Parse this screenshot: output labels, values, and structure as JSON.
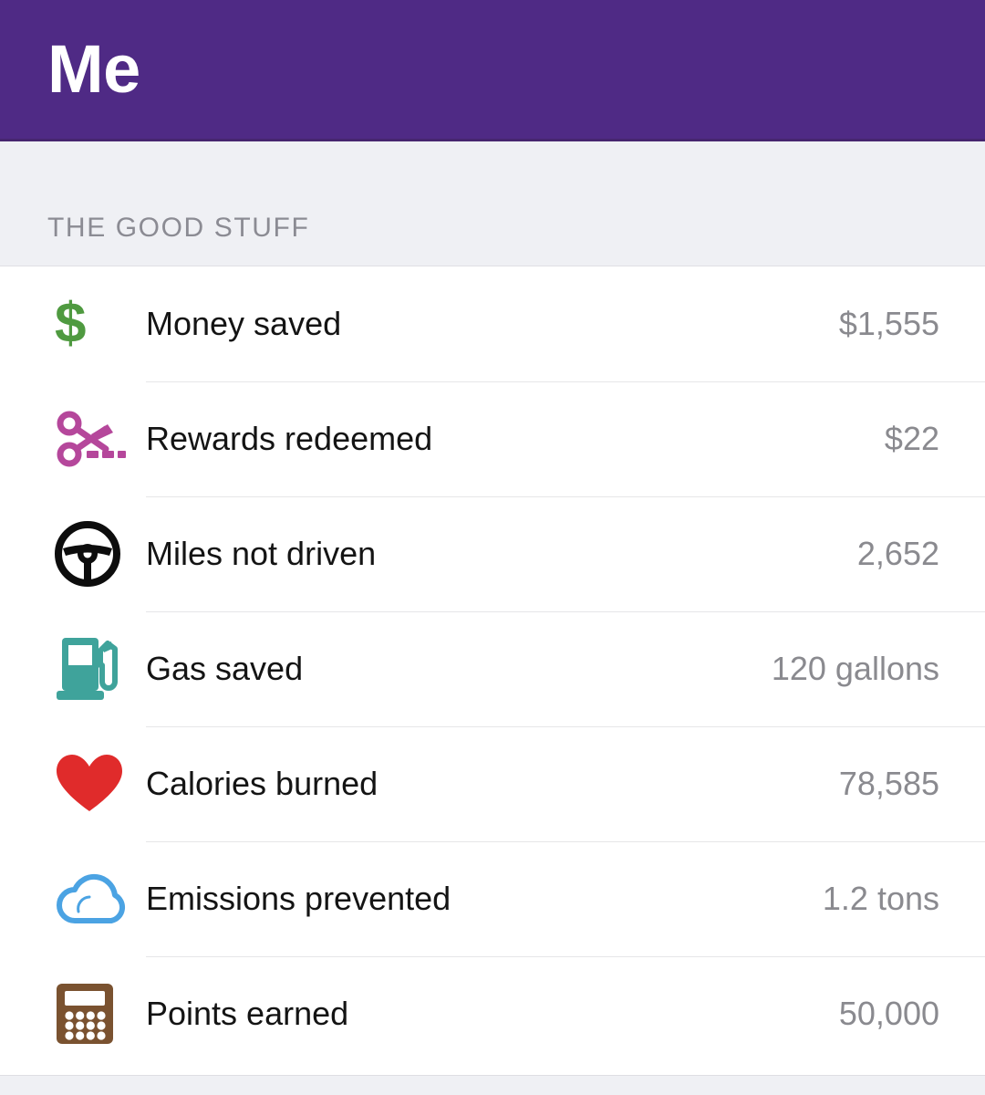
{
  "header": {
    "title": "Me",
    "background_color": "#4F2A85",
    "title_color": "#FFFFFF"
  },
  "section": {
    "title": "THE GOOD STUFF",
    "background_color": "#EFF0F4",
    "title_color": "#8B8B93"
  },
  "stats": {
    "label_color": "#141414",
    "value_color": "#8A8A8F",
    "divider_color": "#E6E6E8",
    "rows": [
      {
        "icon": "dollar-sign-icon",
        "icon_color": "#4F9A40",
        "label": "Money saved",
        "value": "$1,555"
      },
      {
        "icon": "scissors-coupon-icon",
        "icon_color": "#B5479B",
        "label": "Rewards redeemed",
        "value": "$22"
      },
      {
        "icon": "steering-wheel-icon",
        "icon_color": "#0D0D0D",
        "label": "Miles not driven",
        "value": "2,652"
      },
      {
        "icon": "gas-pump-icon",
        "icon_color": "#3FA39B",
        "label": "Gas saved",
        "value": "120 gallons"
      },
      {
        "icon": "heart-icon",
        "icon_color": "#E02B २B",
        "label": "Calories burned",
        "value": "78,585"
      },
      {
        "icon": "cloud-icon",
        "icon_color": "#4BA3E3",
        "label": "Emissions prevented",
        "value": "1.2 tons"
      },
      {
        "icon": "calculator-icon",
        "icon_color": "#7A5230",
        "label": "Points earned",
        "value": "50,000"
      }
    ]
  }
}
